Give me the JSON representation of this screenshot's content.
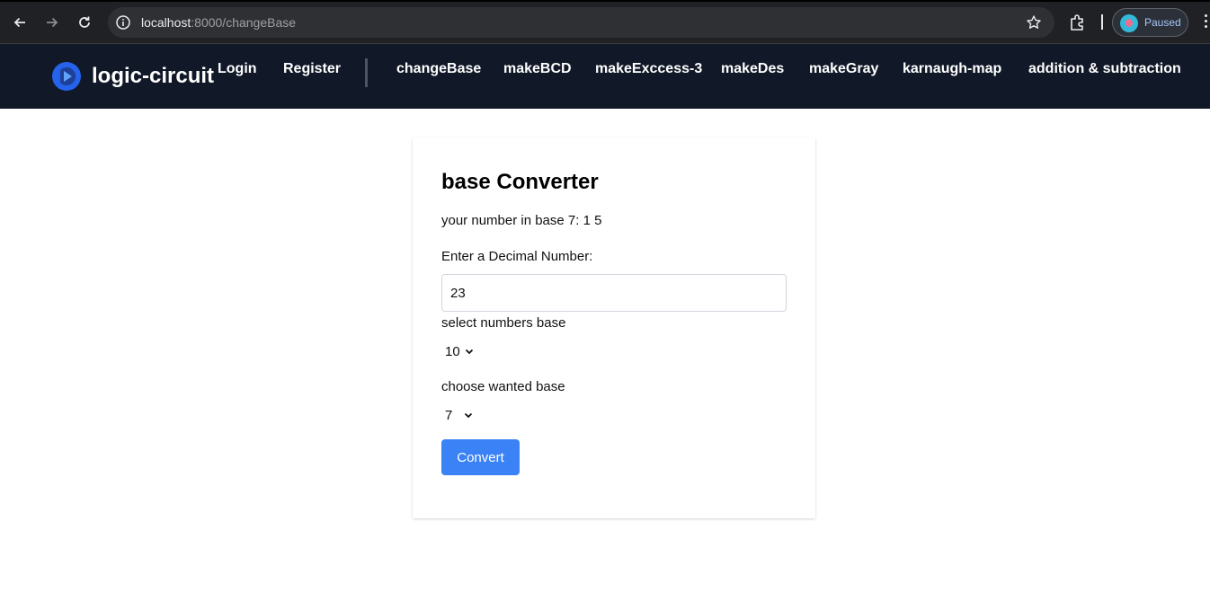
{
  "browser": {
    "url_host": "localhost",
    "url_path": ":8000/changeBase",
    "profile_label": "Paused"
  },
  "navbar": {
    "brand": "logic-circuit",
    "links": [
      {
        "label": "Login"
      },
      {
        "label": "Register"
      },
      {
        "label": "changeBase"
      },
      {
        "label": "makeBCD"
      },
      {
        "label": "makeExccess-3"
      },
      {
        "label": "makeDes"
      },
      {
        "label": "makeGray"
      },
      {
        "label": "karnaugh-map"
      },
      {
        "label": "addition & subtraction"
      }
    ]
  },
  "converter": {
    "title": "base Converter",
    "result": "your number in base 7: 1 5",
    "decimal_label": "Enter a Decimal Number:",
    "decimal_value": "23",
    "from_base_label": "select numbers base",
    "from_base_value": "10",
    "to_base_label": "choose wanted base",
    "to_base_value": "7",
    "convert_label": "Convert"
  },
  "colors": {
    "chrome_bg": "#202124",
    "navbar_bg": "#111827",
    "button_bg": "#3b82f6",
    "logo_blue": "#2563eb"
  }
}
